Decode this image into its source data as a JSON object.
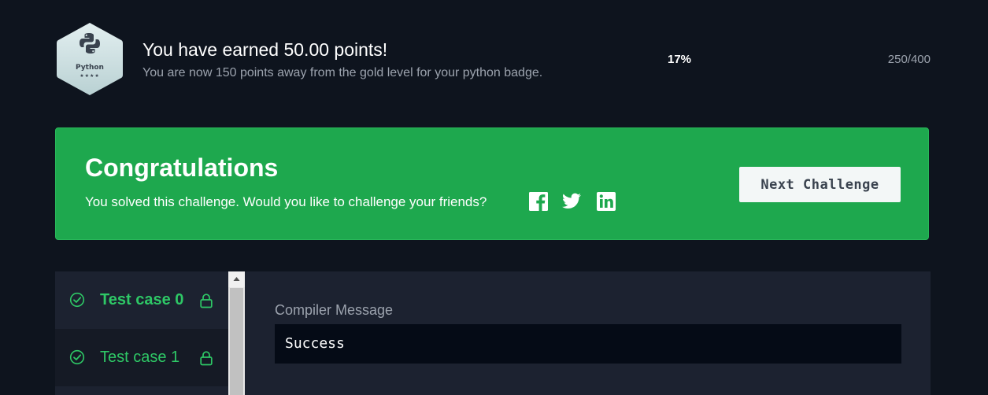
{
  "badge": {
    "label": "Python",
    "stars": "★★★★"
  },
  "earned": {
    "title": "You have earned 50.00 points!",
    "subtitle": "You are now 150 points away from the gold level for your python badge."
  },
  "progress": {
    "percent": "17%",
    "count": "250/400"
  },
  "congrats": {
    "title": "Congratulations",
    "message": "You solved this challenge. Would you like to challenge your friends?",
    "next_button": "Next Challenge"
  },
  "test_cases": [
    {
      "label": "Test case 0",
      "active": true
    },
    {
      "label": "Test case 1",
      "active": false
    }
  ],
  "compiler": {
    "label": "Compiler Message",
    "message": "Success"
  },
  "colors": {
    "success_green": "#1ea84e",
    "text_green": "#2ec866",
    "background": "#0e141e"
  }
}
